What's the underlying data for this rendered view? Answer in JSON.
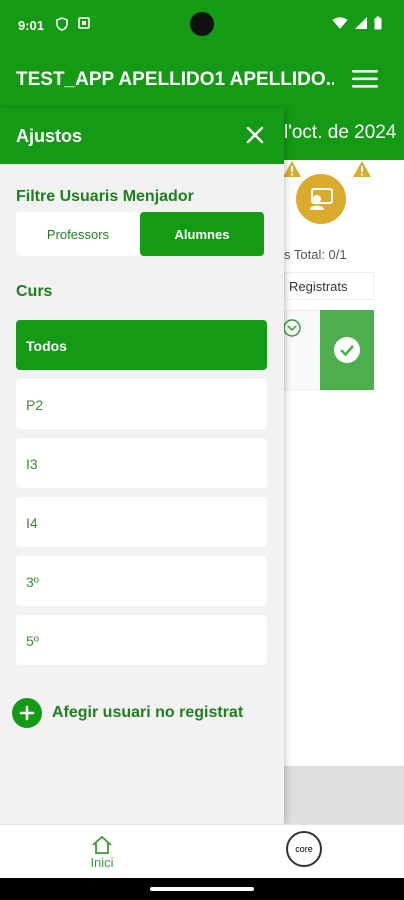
{
  "status_bar": {
    "time": "9:01",
    "left_icons": [
      "shield-icon",
      "notification-icon"
    ],
    "right_icons": [
      "wifi-icon",
      "signal-icon",
      "battery-icon"
    ]
  },
  "app_bar": {
    "title": "TEST_APP APELLIDO1 APELLIDO...",
    "menu_icon": "hamburger-menu-icon"
  },
  "background": {
    "date_partial": "l'oct. de 2024",
    "total_partial": "s   Total: 0/1",
    "tab_partial": "Registrats"
  },
  "drawer": {
    "title": "Ajustos",
    "filter_label": "Filtre Usuaris Menjador",
    "toggle": {
      "professors": "Professors",
      "alumnes": "Alumnes",
      "selected": "Alumnes"
    },
    "curs_label": "Curs",
    "courses": [
      {
        "label": "Todos",
        "selected": true
      },
      {
        "label": "P2",
        "selected": false
      },
      {
        "label": "I3",
        "selected": false
      },
      {
        "label": "I4",
        "selected": false
      },
      {
        "label": "3º",
        "selected": false
      },
      {
        "label": "5º",
        "selected": false
      }
    ],
    "add_user_label": "Afegir usuari no registrat"
  },
  "bottom_nav": {
    "home_label": "Inici",
    "logo_text": "core"
  },
  "colors": {
    "primary": "#149a14",
    "accent_green_text": "#1e7f1e",
    "warning": "#d9aa2c",
    "drawer_bg": "#f2f2f2"
  }
}
